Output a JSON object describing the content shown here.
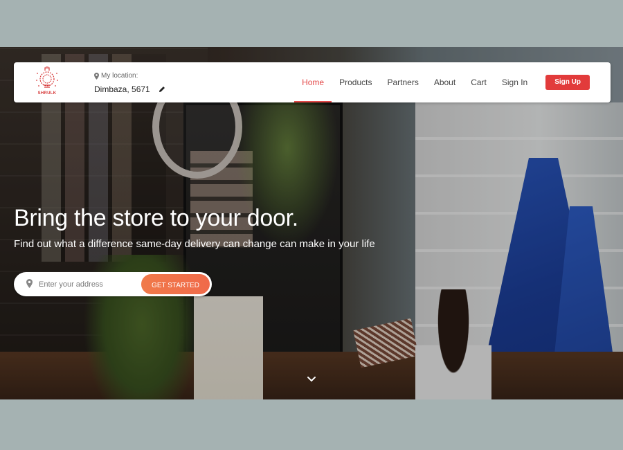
{
  "brand": {
    "name": "SHRULK",
    "accent": "#e23b3b"
  },
  "location": {
    "label": "My location:",
    "value": "Dimbaza, 5671",
    "edit_icon": "pencil-icon",
    "pin_icon": "map-pin-icon"
  },
  "nav": {
    "items": [
      {
        "label": "Home",
        "active": true
      },
      {
        "label": "Products"
      },
      {
        "label": "Partners"
      },
      {
        "label": "About"
      },
      {
        "label": "Cart"
      },
      {
        "label": "Sign In"
      }
    ],
    "signup_label": "Sign Up"
  },
  "hero": {
    "title": "Bring the store to your door.",
    "subtitle": "Find out what a difference same-day delivery can change can make in your life",
    "search_placeholder": "Enter your address",
    "cta_label": "GET STARTED",
    "cta_color": "#f07a4a",
    "scroll_icon": "chevron-down-icon"
  }
}
